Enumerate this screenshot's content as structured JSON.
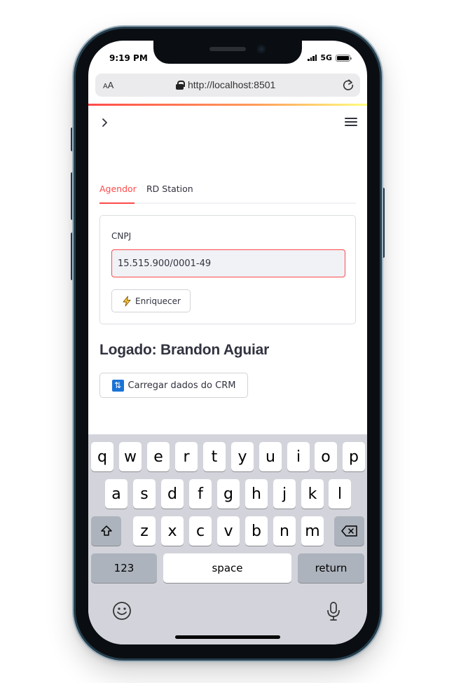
{
  "status_bar": {
    "time": "9:19 PM",
    "network": "5G"
  },
  "browser": {
    "text_size_label": "AA",
    "url": "http://localhost:8501"
  },
  "app": {
    "tabs": [
      {
        "label": "Agendor",
        "active": true
      },
      {
        "label": "RD Station",
        "active": false
      }
    ],
    "form": {
      "cnpj_label": "CNPJ",
      "cnpj_value": "15.515.900/0001-49",
      "enrich_button": "Enriquecer"
    },
    "logged_title": "Logado: Brandon Aguiar",
    "crm_button": "Carregar dados do CRM"
  },
  "keyboard": {
    "row1": [
      "q",
      "w",
      "e",
      "r",
      "t",
      "y",
      "u",
      "i",
      "o",
      "p"
    ],
    "row2": [
      "a",
      "s",
      "d",
      "f",
      "g",
      "h",
      "j",
      "k",
      "l"
    ],
    "row3": [
      "z",
      "x",
      "c",
      "v",
      "b",
      "n",
      "m"
    ],
    "numbers_key": "123",
    "space_key": "space",
    "return_key": "return"
  },
  "colors": {
    "accent": "#ff4b4b",
    "text": "#31333f",
    "keyboard_bg": "#d3d4db"
  }
}
